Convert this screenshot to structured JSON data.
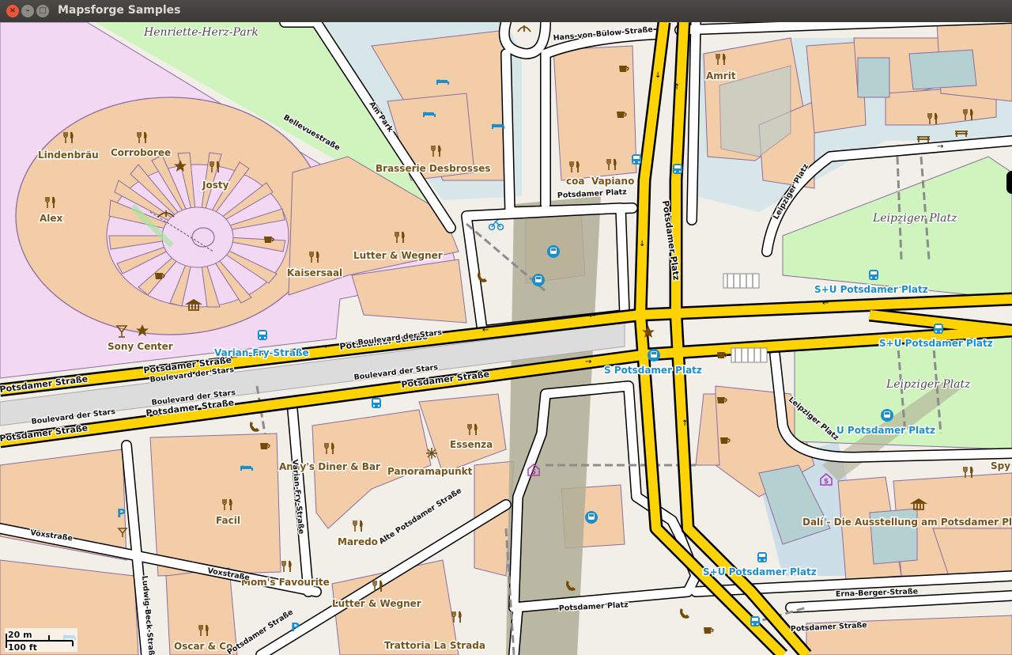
{
  "window": {
    "title": "Mapsforge Samples"
  },
  "colors": {
    "primary_road": "#fdd303",
    "primary_casing": "#000000",
    "building": "#f2cda8",
    "building_outline": "#8b6d9f",
    "park": "#d0f4bd",
    "special_area": "#f3d8f4",
    "water": "#b5d0d0",
    "railway_area": "#b0ad96",
    "stop_label": "#1a8fcf",
    "poi_label": "#7a5218"
  },
  "parks": [
    {
      "label": "Henriette-Herz-Park"
    },
    {
      "label": "Leipziger Platz"
    },
    {
      "label": "Leipziger Platz"
    }
  ],
  "pois": [
    {
      "label": "Lindenbräu",
      "icon": "restaurant-icon"
    },
    {
      "label": "Corroboree",
      "icon": "restaurant-icon"
    },
    {
      "label": "Josty",
      "icon": "restaurant-icon"
    },
    {
      "label": "Alex",
      "icon": "restaurant-icon"
    },
    {
      "label": "Kaisersaal",
      "icon": "restaurant-icon"
    },
    {
      "label": "Lutter & Wegner",
      "icon": "restaurant-icon"
    },
    {
      "label": "Sony Center",
      "icon": "star-icon"
    },
    {
      "label": "Brasserie Desbrosses",
      "icon": "restaurant-icon"
    },
    {
      "label": "coa",
      "icon": "restaurant-icon"
    },
    {
      "label": "Vapiano",
      "icon": "restaurant-icon"
    },
    {
      "label": "Amrit",
      "icon": "restaurant-icon"
    },
    {
      "label": "Andy's Diner & Bar",
      "icon": "restaurant-icon"
    },
    {
      "label": "Essenza",
      "icon": "restaurant-icon"
    },
    {
      "label": "Panoramapunkt",
      "icon": "viewpoint-icon"
    },
    {
      "label": "Facil",
      "icon": "restaurant-icon"
    },
    {
      "label": "Maredo",
      "icon": "restaurant-icon"
    },
    {
      "label": "Mom's Favourite",
      "icon": "restaurant-icon"
    },
    {
      "label": "Lutter & Wegner",
      "icon": "restaurant-icon"
    },
    {
      "label": "Oscar & Co",
      "icon": "restaurant-icon"
    },
    {
      "label": "Trattoria La Strada",
      "icon": "restaurant-icon"
    },
    {
      "label": "Dalí - Die Ausstellung am Potsdamer Pl",
      "icon": "museum-icon"
    },
    {
      "label": "Spy",
      "icon": "restaurant-icon"
    }
  ],
  "stops": [
    {
      "label": "Varian-Fry-Straße"
    },
    {
      "label": "S+U Potsdamer Platz"
    },
    {
      "label": "S+U Potsdamer Platz"
    },
    {
      "label": "S Potsdamer Platz"
    },
    {
      "label": "U Potsdamer Platz"
    },
    {
      "label": "S+U Potsdamer Platz"
    }
  ],
  "streets": [
    {
      "label": "Hans-von-Bülow-Straße"
    },
    {
      "label": "Bellevuestraße"
    },
    {
      "label": "Am Park"
    },
    {
      "label": "Potsdamer Platz"
    },
    {
      "label": "Potsdamer Platz"
    },
    {
      "label": "Potsdamer Straße"
    },
    {
      "label": "Potsdamer Straße"
    },
    {
      "label": "Potsdamer Straße"
    },
    {
      "label": "Potsdamer Straße"
    },
    {
      "label": "Potsdamer Straße"
    },
    {
      "label": "Potsdamer Straße"
    },
    {
      "label": "Boulevard der Stars"
    },
    {
      "label": "Boulevard der Stars"
    },
    {
      "label": "Boulevard der Stars"
    },
    {
      "label": "Boulevard der Stars"
    },
    {
      "label": "Boulevard der Stars"
    },
    {
      "label": "Leipziger Platz"
    },
    {
      "label": "Leipziger Platz"
    },
    {
      "label": "Voxstraße"
    },
    {
      "label": "Voxstraße"
    },
    {
      "label": "Varian-Fry-Straße"
    },
    {
      "label": "Ludwig-Beck-Straße"
    },
    {
      "label": "Alte Potsdamer Straße"
    },
    {
      "label": "Erna-Berger-Straße"
    },
    {
      "label": "Potsdamer Platz"
    },
    {
      "label": "Potsdamer Straße"
    },
    {
      "label": "Potsdamer Straße"
    }
  ],
  "scale": {
    "metric": "20 m",
    "imperial": "100 ft"
  },
  "parking": {
    "label": "P"
  }
}
